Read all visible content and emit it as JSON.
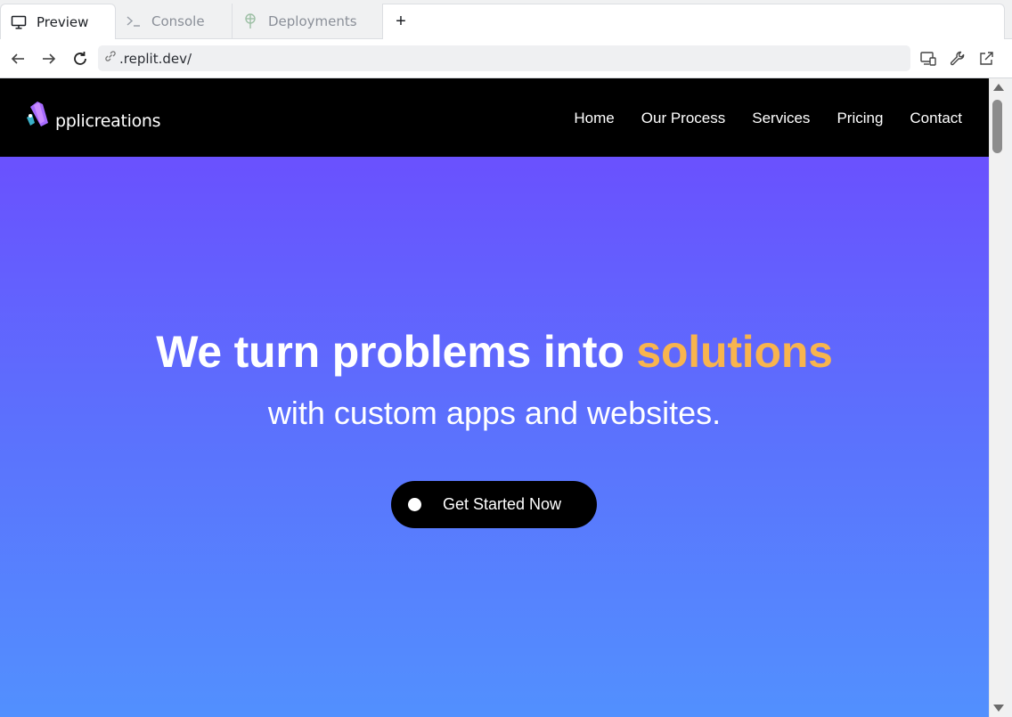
{
  "browser": {
    "tabs": [
      {
        "label": "Preview",
        "icon": "monitor-icon",
        "active": true
      },
      {
        "label": "Console",
        "icon": "terminal-icon",
        "active": false
      },
      {
        "label": "Deployments",
        "icon": "deploy-icon",
        "active": false
      }
    ],
    "new_tab_label": "+",
    "url": ".replit.dev/"
  },
  "site": {
    "logo_text": "pplicreations",
    "nav": [
      "Home",
      "Our Process",
      "Services",
      "Pricing",
      "Contact"
    ],
    "hero": {
      "headline_main": "We turn problems into ",
      "headline_accent": "solutions",
      "subheadline": "with custom apps and websites.",
      "cta_label": "Get Started Now"
    },
    "colors": {
      "header_bg": "#000000",
      "hero_top": "#6a51fe",
      "hero_bottom": "#5290fe",
      "accent": "#f8b44e",
      "cta_bg": "#000000"
    }
  }
}
